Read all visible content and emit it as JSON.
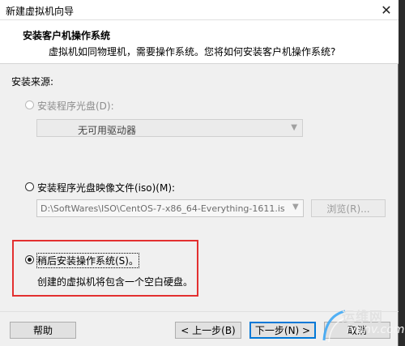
{
  "window": {
    "title": "新建虚拟机向导",
    "close_glyph": "✕"
  },
  "header": {
    "title": "安装客户机操作系统",
    "description": "虚拟机如同物理机，需要操作系统。您将如何安装客户机操作系统?"
  },
  "source": {
    "label": "安装来源:",
    "options": [
      {
        "label": "安装程序光盘(D):",
        "selected": false,
        "enabled": false
      },
      {
        "label": "安装程序光盘映像文件(iso)(M):",
        "selected": false,
        "enabled": true
      },
      {
        "label": "稍后安装操作系统(S)。",
        "selected": true,
        "enabled": true
      }
    ],
    "drive_select_value": "无可用驱动器",
    "iso_path": "D:\\SoftWares\\ISO\\CentOS-7-x86_64-Everything-1611.is",
    "browse_label": "浏览(R)...",
    "later_description": "创建的虚拟机将包含一个空白硬盘。"
  },
  "footer": {
    "help_label": "帮助",
    "back_label": "< 上一步(B)",
    "next_label": "下一步(N) >",
    "cancel_label": "取消"
  },
  "watermark": {
    "text": "运维网",
    "url": "iyunv.com"
  },
  "colors": {
    "highlight_border": "#e33030",
    "default_button_border": "#0078d7"
  }
}
